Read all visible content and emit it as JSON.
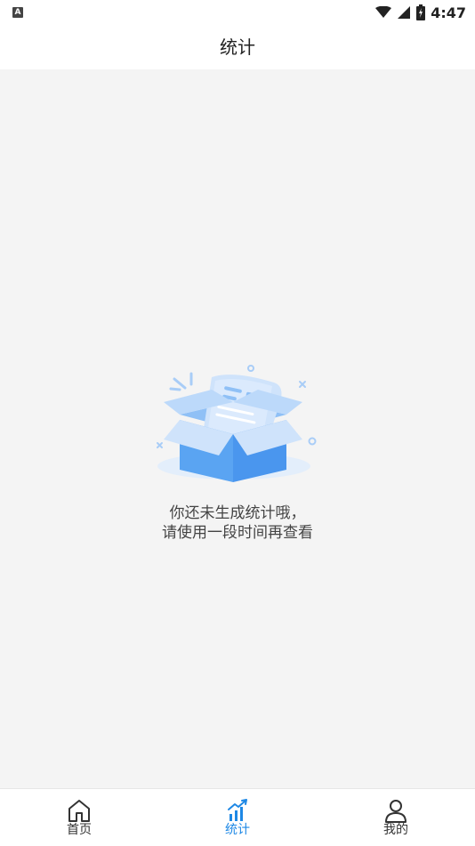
{
  "status_bar": {
    "notification_badge": "A",
    "time": "4:47",
    "icons": [
      "wifi-icon",
      "cell-signal-icon",
      "battery-icon"
    ]
  },
  "header": {
    "title": "统计"
  },
  "empty_state": {
    "icon": "empty-box-icon",
    "line1": "你还未生成统计哦，",
    "line2": "请使用一段时间再查看"
  },
  "tab_bar": {
    "active_color": "#1e88e5",
    "tabs": [
      {
        "label": "首页",
        "icon": "home-icon",
        "active": false
      },
      {
        "label": "统计",
        "icon": "stats-icon",
        "active": true
      },
      {
        "label": "我的",
        "icon": "user-icon",
        "active": false
      }
    ]
  }
}
